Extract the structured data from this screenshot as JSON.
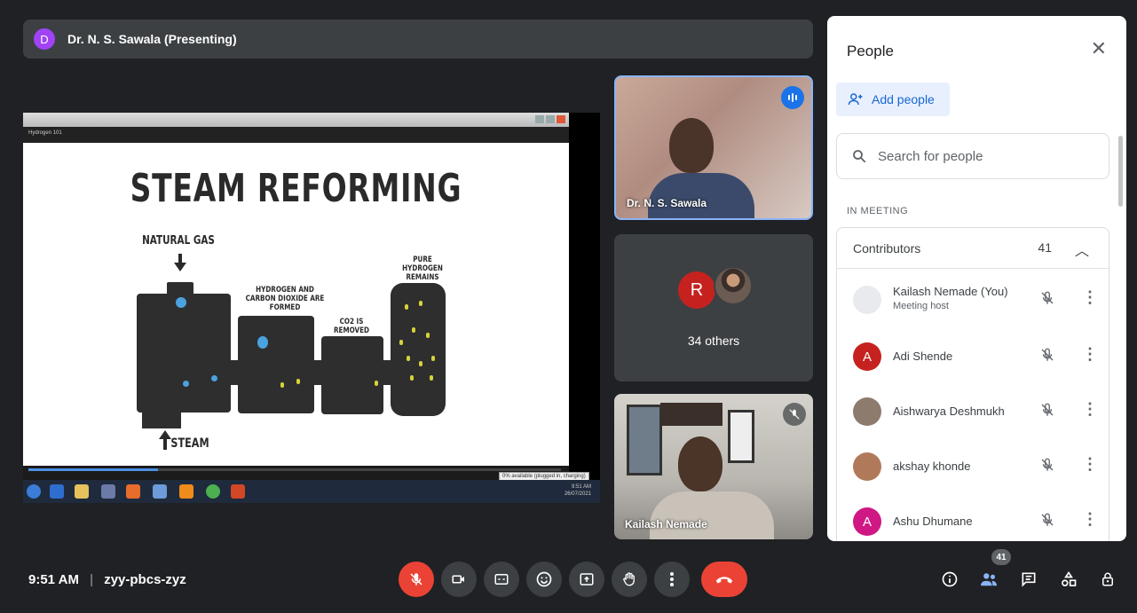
{
  "presenter": {
    "avatar_letter": "D",
    "label": "Dr. N. S. Sawala (Presenting)"
  },
  "slide": {
    "window_title": "Hydrogen 101",
    "title": "STEAM REFORMING",
    "labels": {
      "natural_gas": "NATURAL GAS",
      "hydrogen_formed": "HYDROGEN AND CARBON DIOXIDE ARE FORMED",
      "co2_removed": "CO2 IS REMOVED",
      "pure_hydrogen": "PURE HYDROGEN REMAINS",
      "steam": "STEAM"
    },
    "taskbar_time": "9:51 AM",
    "taskbar_date": "26/07/2021",
    "tooltip": "0% available (plugged in, charging)"
  },
  "tiles": {
    "speaker_name": "Dr. N. S. Sawala",
    "others_avatar_letter": "R",
    "others_label": "34 others",
    "self_name": "Kailash Nemade"
  },
  "people_panel": {
    "title": "People",
    "add_people_label": "Add people",
    "search_placeholder": "Search for people",
    "section_label": "IN MEETING",
    "contributors_label": "Contributors",
    "contributors_count": "41",
    "participants": [
      {
        "name": "Kailash Nemade (You)",
        "sub": "Meeting host",
        "avatar": "",
        "color": "#e8eaed"
      },
      {
        "name": "Adi Shende",
        "sub": "",
        "avatar": "A",
        "color": "#c5221f"
      },
      {
        "name": "Aishwarya Deshmukh",
        "sub": "",
        "avatar": "",
        "color": "#8d7b6e"
      },
      {
        "name": "akshay khonde",
        "sub": "",
        "avatar": "",
        "color": "#b07a5a"
      },
      {
        "name": "Ashu Dhumane",
        "sub": "",
        "avatar": "A",
        "color": "#d01884"
      }
    ]
  },
  "bottom_bar": {
    "time": "9:51 AM",
    "separator": "|",
    "meeting_code": "zyy-pbcs-zyz",
    "people_badge": "41"
  }
}
